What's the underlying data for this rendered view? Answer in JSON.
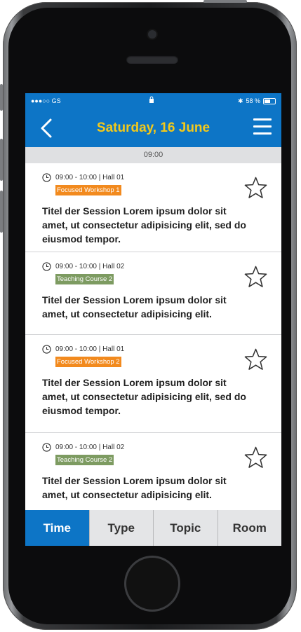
{
  "status": {
    "carrier": "●●●○○ GS",
    "battery": "58 %",
    "battery_level": 0.58
  },
  "header": {
    "title": "Saturday, 16 June"
  },
  "time_section": "09:00",
  "sessions": [
    {
      "time": "09:00 - 10:00  |  Hall 01",
      "tag": "Focused Workshop 1",
      "tag_color": "#f28a1e",
      "title": "Titel der Session Lorem ipsum dolor sit amet, ut consectetur adipisicing elit, sed do eiusmod tempor."
    },
    {
      "time": "09:00 - 10:00  |  Hall 02",
      "tag": "Teaching Course 2",
      "tag_color": "#7d9b61",
      "title": "Titel der Session Lorem ipsum dolor sit amet, ut consectetur adipisicing elit."
    },
    {
      "time": "09:00 - 10:00  |  Hall 01",
      "tag": "Focused Workshop 2",
      "tag_color": "#f28a1e",
      "title": "Titel der Session Lorem ipsum dolor sit amet, ut consectetur adipisicing elit, sed do eiusmod tempor."
    },
    {
      "time": "09:00 - 10:00  |  Hall 02",
      "tag": "Teaching Course 2",
      "tag_color": "#7d9b61",
      "title": "Titel der Session Lorem ipsum dolor sit amet, ut consectetur adipisicing elit."
    }
  ],
  "tabs": [
    {
      "label": "Time",
      "active": true
    },
    {
      "label": "Type",
      "active": false
    },
    {
      "label": "Topic",
      "active": false
    },
    {
      "label": "Room",
      "active": false
    }
  ],
  "colors": {
    "accent": "#0d75c6",
    "title_yellow": "#f3c91a"
  }
}
